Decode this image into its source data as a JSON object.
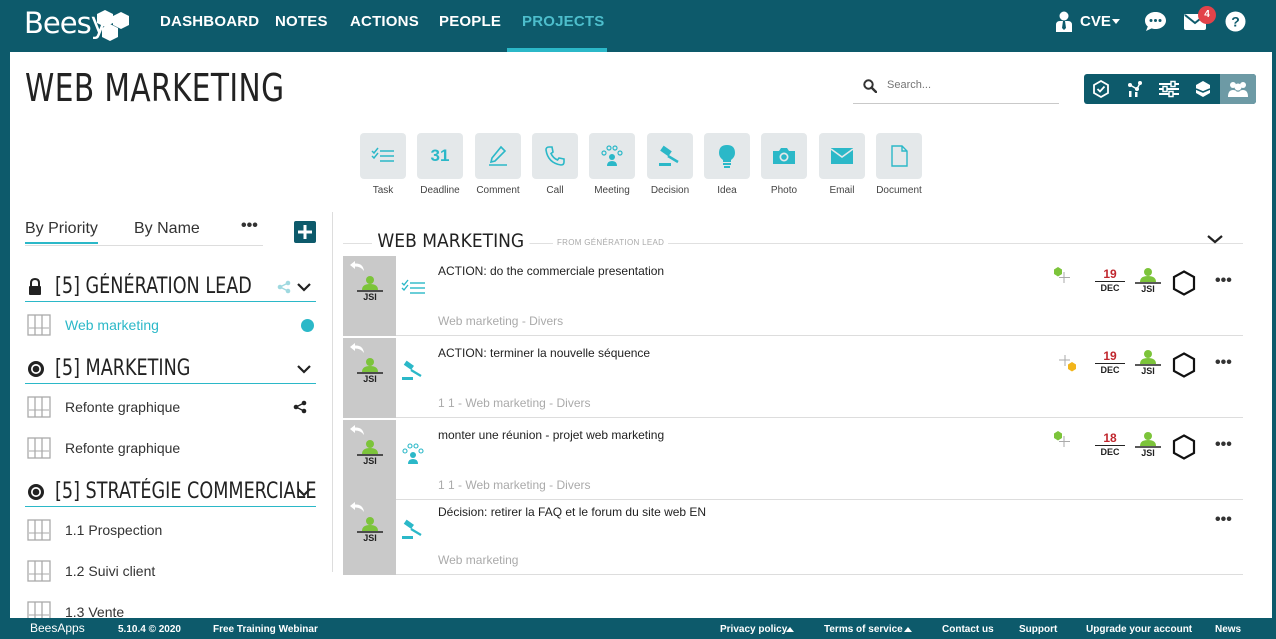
{
  "app": {
    "logo": "Beesy"
  },
  "nav": {
    "items": [
      "DASHBOARD",
      "NOTES",
      "ACTIONS",
      "PEOPLE",
      "PROJECTS"
    ],
    "active": "PROJECTS",
    "user": "CVE",
    "notifications": "4"
  },
  "page": {
    "title": "WEB MARKETING"
  },
  "search": {
    "placeholder": "Search..."
  },
  "toolbar": {
    "items": [
      "Task",
      "Deadline",
      "Comment",
      "Call",
      "Meeting",
      "Decision",
      "Idea",
      "Photo",
      "Email",
      "Document"
    ],
    "deadline_glyph": "31"
  },
  "sidebar": {
    "tabs": [
      "By Priority",
      "By Name"
    ],
    "more": "•••",
    "groups": [
      {
        "title": "[5] GÉNÉRATION LEAD",
        "items": [
          "Web marketing"
        ]
      },
      {
        "title": "[5] MARKETING",
        "items": [
          "Refonte graphique",
          "Refonte graphique"
        ]
      },
      {
        "title": "[5] STRATÉGIE COMMERCIALE",
        "items": [
          "1.1 Prospection",
          "1.2 Suivi client",
          "1.3 Vente"
        ]
      }
    ]
  },
  "content": {
    "title": "WEB MARKETING",
    "subtitle": "FROM GÉNÉRATION LEAD",
    "rows": [
      {
        "initials": "JSI",
        "title": "ACTION: do the commerciale presentation",
        "meta": "Web marketing - Divers",
        "day": "19",
        "month": "DEC",
        "owner": "JSI"
      },
      {
        "initials": "JSI",
        "title": "ACTION: terminer la nouvelle séquence",
        "meta": "1  1  - Web marketing - Divers",
        "day": "19",
        "month": "DEC",
        "owner": "JSI"
      },
      {
        "initials": "JSI",
        "title": "monter une réunion - projet web marketing",
        "meta": "1  1  - Web marketing - Divers",
        "day": "18",
        "month": "DEC",
        "owner": "JSI"
      },
      {
        "initials": "JSI",
        "title": "Décision: retirer la FAQ et le forum du site web EN",
        "meta": "Web marketing"
      }
    ],
    "more": "•••"
  },
  "footer": {
    "logo": "BeesApps",
    "version": "5.10.4 © 2020",
    "webinar": "Free Training Webinar",
    "privacy": "Privacy policy",
    "terms": "Terms of service",
    "contact": "Contact us",
    "support": "Support",
    "upgrade": "Upgrade your account",
    "news": "News"
  },
  "colors": {
    "teal_dark": "#0d5a6b",
    "teal": "#2bb8c8",
    "red": "#c0262d",
    "green": "#7cc43a",
    "yellow": "#f2b51b"
  }
}
